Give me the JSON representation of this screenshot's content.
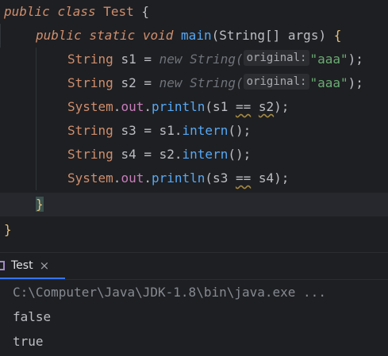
{
  "editor": {
    "lines": [
      {
        "parts": [
          "public",
          " ",
          "class",
          " ",
          "Test",
          " ",
          "{"
        ]
      },
      {
        "parts": [
          "public",
          " ",
          "static",
          " ",
          "void",
          " ",
          "main",
          "(",
          "String[]",
          " args) ",
          "{"
        ]
      }
    ],
    "line1": {
      "kw1": "public",
      "kw2": "class",
      "name": "Test",
      "brace": "{"
    },
    "line2": {
      "kw1": "public",
      "kw2": "static",
      "kw3": "void",
      "fn": "main",
      "open": "(",
      "params": "String[] args",
      "close": ")",
      "brace": "{"
    },
    "line3": {
      "type": "String",
      "var": "s1",
      "eq": "=",
      "new": "new",
      "ctor": "String(",
      "hint": "original:",
      "str": "\"aaa\"",
      "end": ");"
    },
    "line4": {
      "type": "String",
      "var": "s2",
      "eq": "=",
      "new": "new",
      "ctor": "String(",
      "hint": "original:",
      "str": "\"aaa\"",
      "end": ");"
    },
    "line5": {
      "cls": "System",
      "dot1": ".",
      "field": "out",
      "dot2": ".",
      "fn": "println",
      "open": "(s1 ",
      "op": "==",
      "arg": "s2",
      "end": ");"
    },
    "line6": {
      "type": "String",
      "var": "s3",
      "eq": "=",
      "obj": "s1.",
      "fn": "intern",
      "end": "();"
    },
    "line7": {
      "type": "String",
      "var": "s4",
      "eq": "=",
      "obj": "s2.",
      "fn": "intern",
      "end": "();"
    },
    "line8": {
      "cls": "System",
      "dot1": ".",
      "field": "out",
      "dot2": ".",
      "fn": "println",
      "open": "(s3 ",
      "op": "==",
      "arg": "s4",
      "end": ");"
    },
    "line9": {
      "brace": "}"
    },
    "line10": {
      "brace": "}"
    }
  },
  "run_panel": {
    "tab_label": "Test",
    "close_glyph": "×",
    "command": "C:\\Computer\\Java\\JDK-1.8\\bin\\java.exe ...",
    "output": [
      "false",
      "true"
    ]
  },
  "colors": {
    "background": "#1e1f22",
    "keyword": "#cf8e6d",
    "function": "#56a8f5",
    "string": "#6aab73",
    "field": "#c77dbb",
    "tab_underline": "#3574f0"
  }
}
